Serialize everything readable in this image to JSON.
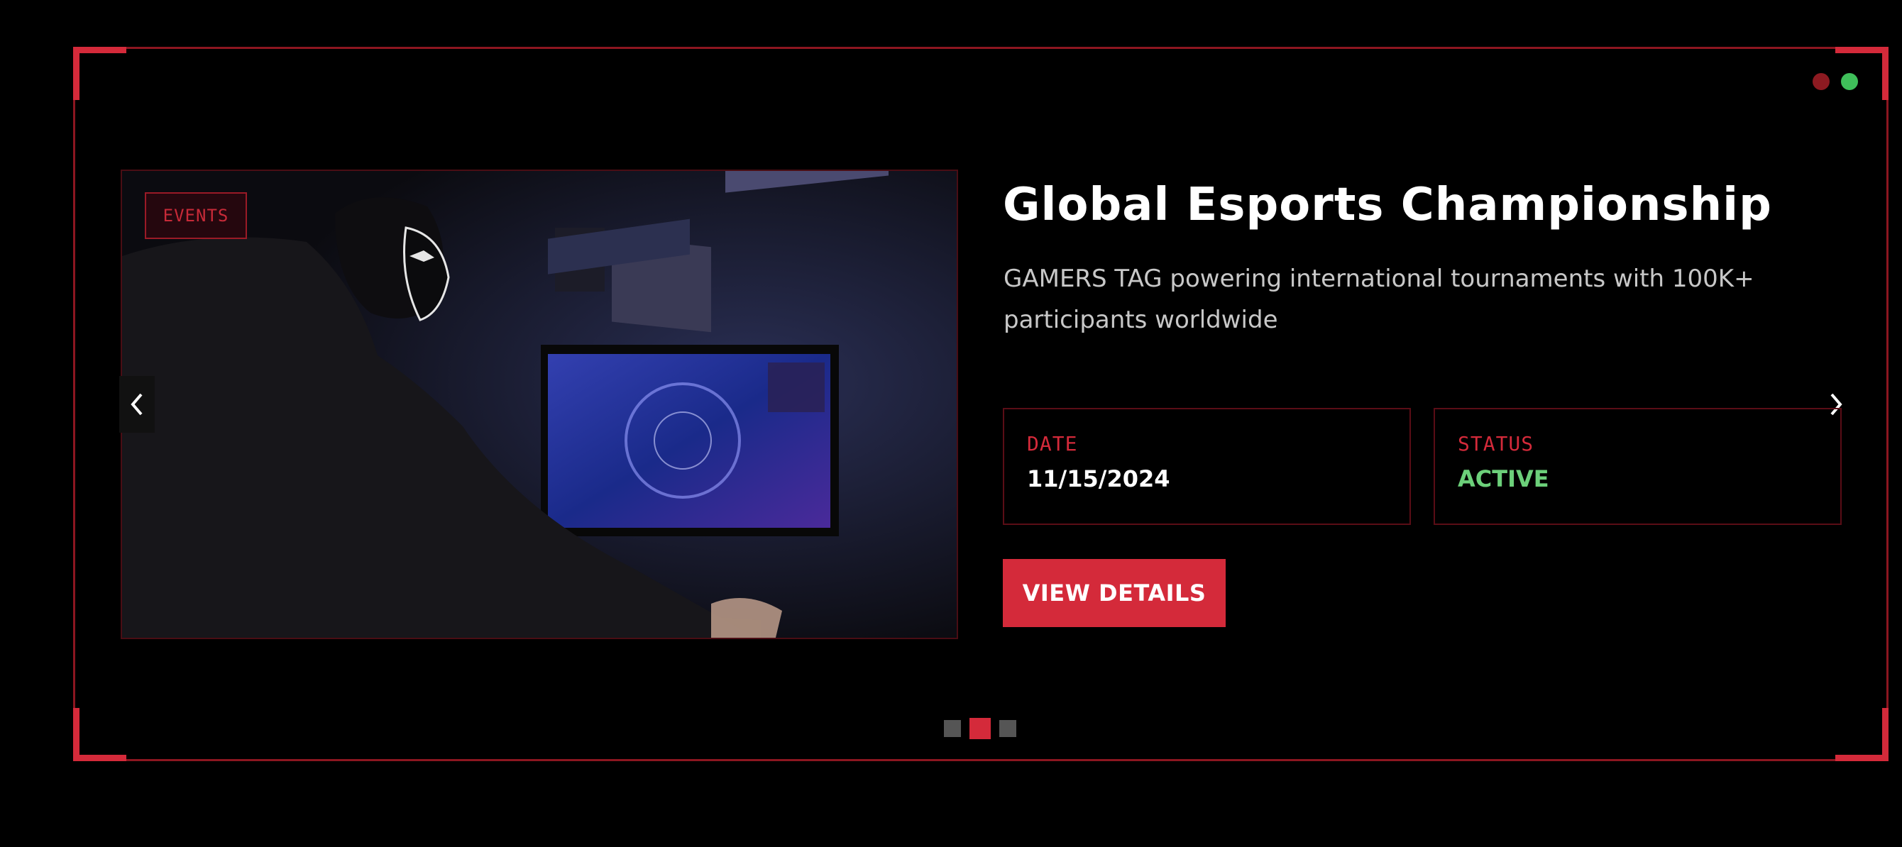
{
  "slide": {
    "tag": "EVENTS",
    "title": "Global Esports Championship",
    "description": "GAMERS TAG powering international tournaments with 100K+ participants worldwide",
    "cards": {
      "date": {
        "label": "DATE",
        "value": "11/15/2024"
      },
      "status": {
        "label": "STATUS",
        "value": "ACTIVE"
      }
    },
    "cta_label": "VIEW DETAILS",
    "image_alt_subject": "esports-player-photo"
  },
  "carousel": {
    "total_slides": 3,
    "active_index": 1
  },
  "colors": {
    "accent": "#d42a3a",
    "frame": "#8c1620",
    "active_status": "#6cd07a",
    "indicator_red": "#8d1a21",
    "indicator_green": "#3fbf5a"
  }
}
